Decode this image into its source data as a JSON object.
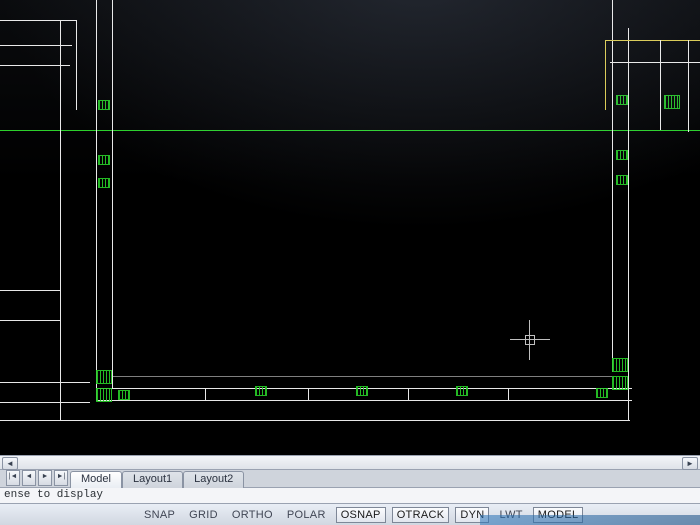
{
  "tabs": {
    "model": "Model",
    "layout1": "Layout1",
    "layout2": "Layout2",
    "active_index": 0
  },
  "command_line": {
    "text": "ense to display"
  },
  "status_toggles": {
    "snap": "SNAP",
    "grid": "GRID",
    "ortho": "ORTHO",
    "polar": "POLAR",
    "osnap": "OSNAP",
    "otrack": "OTRACK",
    "dyn": "DYN",
    "lwt": "LWT",
    "model": "MODEL"
  },
  "scrollbar": {
    "left_glyph": "◄",
    "right_glyph": "►"
  },
  "tab_arrows": {
    "first": "|◄",
    "prev": "◄",
    "next": "►",
    "last": "►|"
  },
  "colors": {
    "canvas_bg": "#000000",
    "line": "#e8e8e8",
    "green": "#29cf29",
    "yellow": "#d8c84a",
    "ui_bg": "#d9dde2"
  }
}
